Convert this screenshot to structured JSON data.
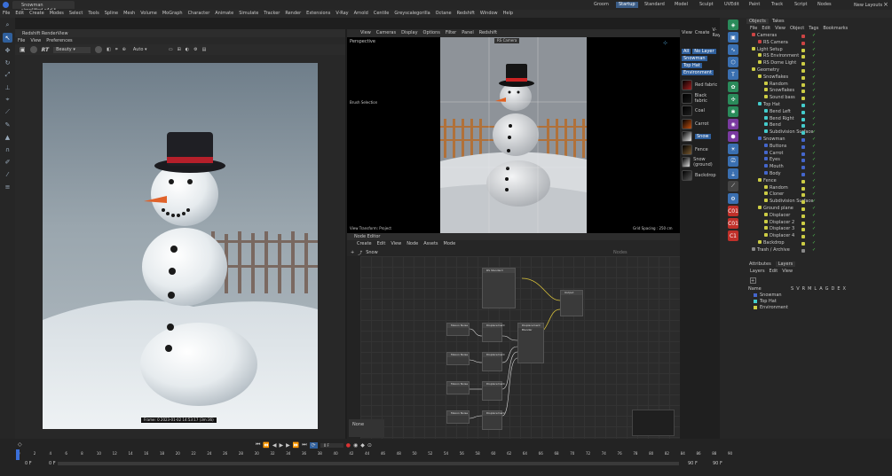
{
  "window": {
    "title": "Snowman simplified.c4d *"
  },
  "layout_tabs": [
    {
      "label": "Groom"
    },
    {
      "label": "Startup"
    },
    {
      "label": "Standard"
    },
    {
      "label": "Model"
    },
    {
      "label": "Sculpt"
    },
    {
      "label": "UVEdit"
    },
    {
      "label": "Paint"
    },
    {
      "label": "Track"
    },
    {
      "label": "Script"
    },
    {
      "label": "Nodes"
    }
  ],
  "new_layouts": "New Layouts",
  "menus": [
    "File",
    "Edit",
    "Create",
    "Modes",
    "Select",
    "Tools",
    "Spline",
    "Mesh",
    "Volume",
    "MoGraph",
    "Character",
    "Animate",
    "Simulate",
    "Tracker",
    "Render",
    "Extensions",
    "V-Ray",
    "Arnold",
    "Centile",
    "Greyscalegorilla",
    "Octane",
    "Redshift",
    "Window",
    "Help"
  ],
  "render_view": {
    "title": "Redshift RenderView",
    "menus": [
      "File",
      "View",
      "Preferences"
    ],
    "aov": "Beauty",
    "auto": "Auto",
    "frame_label": "Frame:  0  2023-01-02  14:53:17  (3m:36)"
  },
  "viewport": {
    "name": "Perspective",
    "menus": [
      "View",
      "Cameras",
      "Display",
      "Options",
      "Filter",
      "Panel",
      "Redshift"
    ],
    "camera": "RS Camera",
    "brush": "Brush Selection",
    "status": "View Transform: Project",
    "grid": "Grid Spacing : 250 cm"
  },
  "node_editor": {
    "title": "Node Editor",
    "menus": [
      "Create",
      "Edit",
      "View",
      "Node",
      "Assets",
      "Mode"
    ],
    "path": "Snow",
    "search": "Nodes",
    "nodes": [
      {
        "title": "RS Standard"
      },
      {
        "title": "Output"
      },
      {
        "title": "Maxon Noise"
      },
      {
        "title": "Displacement"
      },
      {
        "title": "Displacement Blender"
      },
      {
        "title": "Maxon Noise"
      },
      {
        "title": "Displacement"
      },
      {
        "title": "Maxon Noise"
      },
      {
        "title": "Displacement"
      },
      {
        "title": "Maxon Noise"
      },
      {
        "title": "Displacement"
      }
    ],
    "info": "None"
  },
  "layer_panel": {
    "menus": [
      "View",
      "Create",
      "V-Ray"
    ],
    "buttons": [
      "All",
      "No Layer",
      "Snowman",
      "Top Hat",
      "Environment"
    ],
    "materials": [
      {
        "name": "Red fabric",
        "color": "#a02020"
      },
      {
        "name": "Black fabric",
        "color": "#181818"
      },
      {
        "name": "Coal",
        "color": "#202020"
      },
      {
        "name": "Carrot",
        "color": "#c05010"
      },
      {
        "name": "Snow",
        "color": "#e8e8e8"
      },
      {
        "name": "Fence",
        "color": "#7a5a30"
      },
      {
        "name": "Snow (ground)",
        "color": "#dcdcdc"
      },
      {
        "name": "Backdrop",
        "color": "#555555"
      }
    ]
  },
  "object_manager": {
    "tabs": [
      "Objects",
      "Takes"
    ],
    "menus": [
      "File",
      "Edit",
      "View",
      "Object",
      "Tags",
      "Bookmarks"
    ],
    "objects": [
      {
        "name": "Cameras",
        "depth": 0,
        "color": "#cc4444"
      },
      {
        "name": "RS Camera",
        "depth": 1,
        "color": "#cc4444"
      },
      {
        "name": "Light Setup",
        "depth": 0,
        "color": "#cccc44"
      },
      {
        "name": "RS Environment",
        "depth": 1,
        "color": "#cccc44"
      },
      {
        "name": "RS Dome Light",
        "depth": 1,
        "color": "#cccc44"
      },
      {
        "name": "Geometry",
        "depth": 0,
        "color": "#cccc44"
      },
      {
        "name": "Snowflakes",
        "depth": 1,
        "color": "#cccc44"
      },
      {
        "name": "Random",
        "depth": 2,
        "color": "#cccc44"
      },
      {
        "name": "Snowflakes",
        "depth": 2,
        "color": "#cccc44"
      },
      {
        "name": "Sound bass",
        "depth": 2,
        "color": "#cccc44"
      },
      {
        "name": "Top Hat",
        "depth": 1,
        "color": "#44cccc"
      },
      {
        "name": "Bend Left",
        "depth": 2,
        "color": "#44cccc"
      },
      {
        "name": "Bend Right",
        "depth": 2,
        "color": "#44cccc"
      },
      {
        "name": "Bend",
        "depth": 2,
        "color": "#44cccc"
      },
      {
        "name": "Subdivision Surface",
        "depth": 2,
        "color": "#44cccc"
      },
      {
        "name": "Snowman",
        "depth": 1,
        "color": "#4466cc"
      },
      {
        "name": "Buttons",
        "depth": 2,
        "color": "#4466cc"
      },
      {
        "name": "Carrot",
        "depth": 2,
        "color": "#4466cc"
      },
      {
        "name": "Eyes",
        "depth": 2,
        "color": "#4466cc"
      },
      {
        "name": "Mouth",
        "depth": 2,
        "color": "#4466cc"
      },
      {
        "name": "Body",
        "depth": 2,
        "color": "#4466cc"
      },
      {
        "name": "Fence",
        "depth": 1,
        "color": "#cccc44"
      },
      {
        "name": "Random",
        "depth": 2,
        "color": "#cccc44"
      },
      {
        "name": "Cloner",
        "depth": 2,
        "color": "#cccc44"
      },
      {
        "name": "Subdivision Surface",
        "depth": 2,
        "color": "#cccc44"
      },
      {
        "name": "Ground plane",
        "depth": 1,
        "color": "#cccc44"
      },
      {
        "name": "Displacer",
        "depth": 2,
        "color": "#cccc44"
      },
      {
        "name": "Displacer 2",
        "depth": 2,
        "color": "#cccc44"
      },
      {
        "name": "Displacer 3",
        "depth": 2,
        "color": "#cccc44"
      },
      {
        "name": "Displacer 4",
        "depth": 2,
        "color": "#cccc44"
      },
      {
        "name": "Backdrop",
        "depth": 1,
        "color": "#cccc44"
      },
      {
        "name": "Trash / Archive",
        "depth": 0,
        "color": "#888888"
      }
    ]
  },
  "layer_manager": {
    "tabs": [
      "Attributes",
      "Layers"
    ],
    "menus": [
      "Layers",
      "Edit",
      "View"
    ],
    "header": "Name",
    "columns": [
      "S",
      "V",
      "R",
      "M",
      "L",
      "A",
      "G",
      "D",
      "E",
      "X"
    ],
    "layers": [
      {
        "name": "Snowman",
        "color": "#4466cc"
      },
      {
        "name": "Top Hat",
        "color": "#44cccc"
      },
      {
        "name": "Environment",
        "color": "#cccc44"
      }
    ]
  },
  "timeline": {
    "ticks": [
      "0",
      "2",
      "4",
      "6",
      "8",
      "10",
      "12",
      "14",
      "16",
      "18",
      "20",
      "22",
      "24",
      "26",
      "28",
      "30",
      "32",
      "34",
      "36",
      "38",
      "40",
      "42",
      "44",
      "46",
      "48",
      "50",
      "52",
      "54",
      "56",
      "58",
      "60",
      "62",
      "64",
      "66",
      "68",
      "70",
      "72",
      "74",
      "76",
      "78",
      "80",
      "82",
      "84",
      "86",
      "88",
      "90"
    ],
    "start": "0 F",
    "current": "0 F",
    "field": "0 F",
    "end": "90 F",
    "end2": "90 F"
  }
}
